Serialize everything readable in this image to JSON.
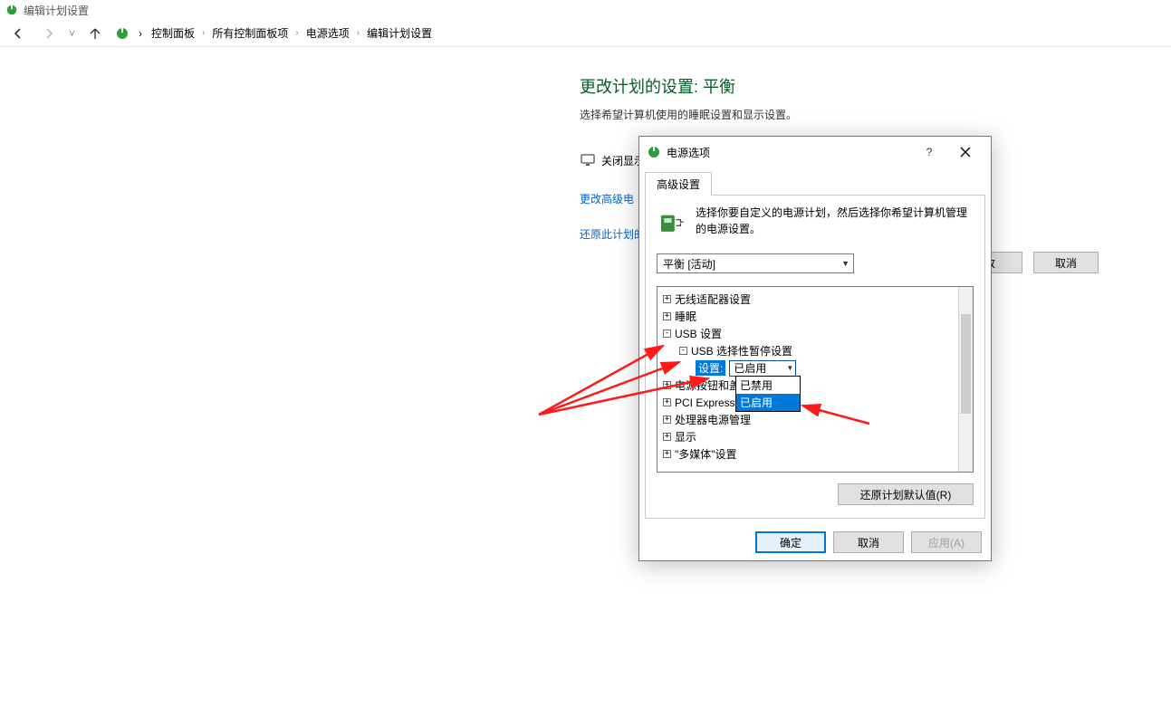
{
  "window": {
    "title": "编辑计划设置"
  },
  "breadcrumbs": {
    "items": [
      "控制面板",
      "所有控制面板项",
      "电源选项",
      "编辑计划设置"
    ]
  },
  "page": {
    "title": "更改计划的设置: 平衡",
    "subtitle": "选择希望计算机使用的睡眠设置和显示设置。",
    "row_display_off": "关闭显示",
    "link_advanced": "更改高级电",
    "link_restore_plan": "还原此计划的",
    "btn_save_partial": "改",
    "btn_cancel": "取消"
  },
  "dialog": {
    "title": "电源选项",
    "help": "?",
    "tab": "高级设置",
    "description": "选择你要自定义的电源计划，然后选择你希望计算机管理的电源设置。",
    "plan_selected": "平衡 [活动]",
    "tree": {
      "n0": "无线适配器设置",
      "n1": "睡眠",
      "n2": "USB 设置",
      "n2a": "USB 选择性暂停设置",
      "setting_label": "设置:",
      "setting_value": "已启用",
      "n3": "电源按钮和盖",
      "n4": "PCI Express",
      "n5": "处理器电源管理",
      "n6": "显示",
      "n7": "\"多媒体\"设置"
    },
    "dropdown": {
      "opt0": "已禁用",
      "opt1": "已启用"
    },
    "restore_defaults": "还原计划默认值(R)",
    "ok": "确定",
    "cancel": "取消",
    "apply": "应用(A)"
  }
}
